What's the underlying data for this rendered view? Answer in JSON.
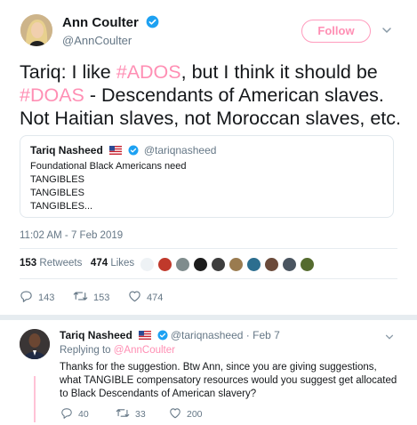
{
  "tweet": {
    "author_name": "Ann Coulter",
    "author_handle": "@AnnCoulter",
    "follow_label": "Follow",
    "text_1": "Tariq: I like ",
    "hashtag_1": "#ADOS",
    "text_2": ", but I think it should be ",
    "hashtag_2": "#DOAS",
    "text_3": " - Descendants of American slaves. Not Haitian slaves, not Moroccan slaves, etc.",
    "timestamp": "11:02 AM - 7 Feb 2019",
    "retweets_count": "153",
    "retweets_label": "Retweets",
    "likes_count": "474",
    "likes_label": "Likes",
    "actions": {
      "reply_count": "143",
      "retweet_count": "153",
      "like_count": "474"
    }
  },
  "quoted_tweet": {
    "name": "Tariq Nasheed",
    "handle": "@tariqnasheed",
    "body": "Foundational Black Americans need\nTANGIBLES\nTANGIBLES\nTANGIBLES..."
  },
  "reply": {
    "name": "Tariq Nasheed",
    "handle": "@tariqnasheed",
    "date": "Feb 7",
    "replying_prefix": "Replying to",
    "replying_to": "@AnnCoulter",
    "body": "Thanks for the suggestion. Btw Ann, since you are giving suggestions, what TANGIBLE compensatory resources would you suggest get allocated to Black Descendants of American slavery?",
    "actions": {
      "reply_count": "40",
      "retweet_count": "33",
      "like_count": "200"
    }
  },
  "colors": {
    "accent": "#ff8fb4",
    "verified": "#1da1f2",
    "muted": "#657786"
  }
}
